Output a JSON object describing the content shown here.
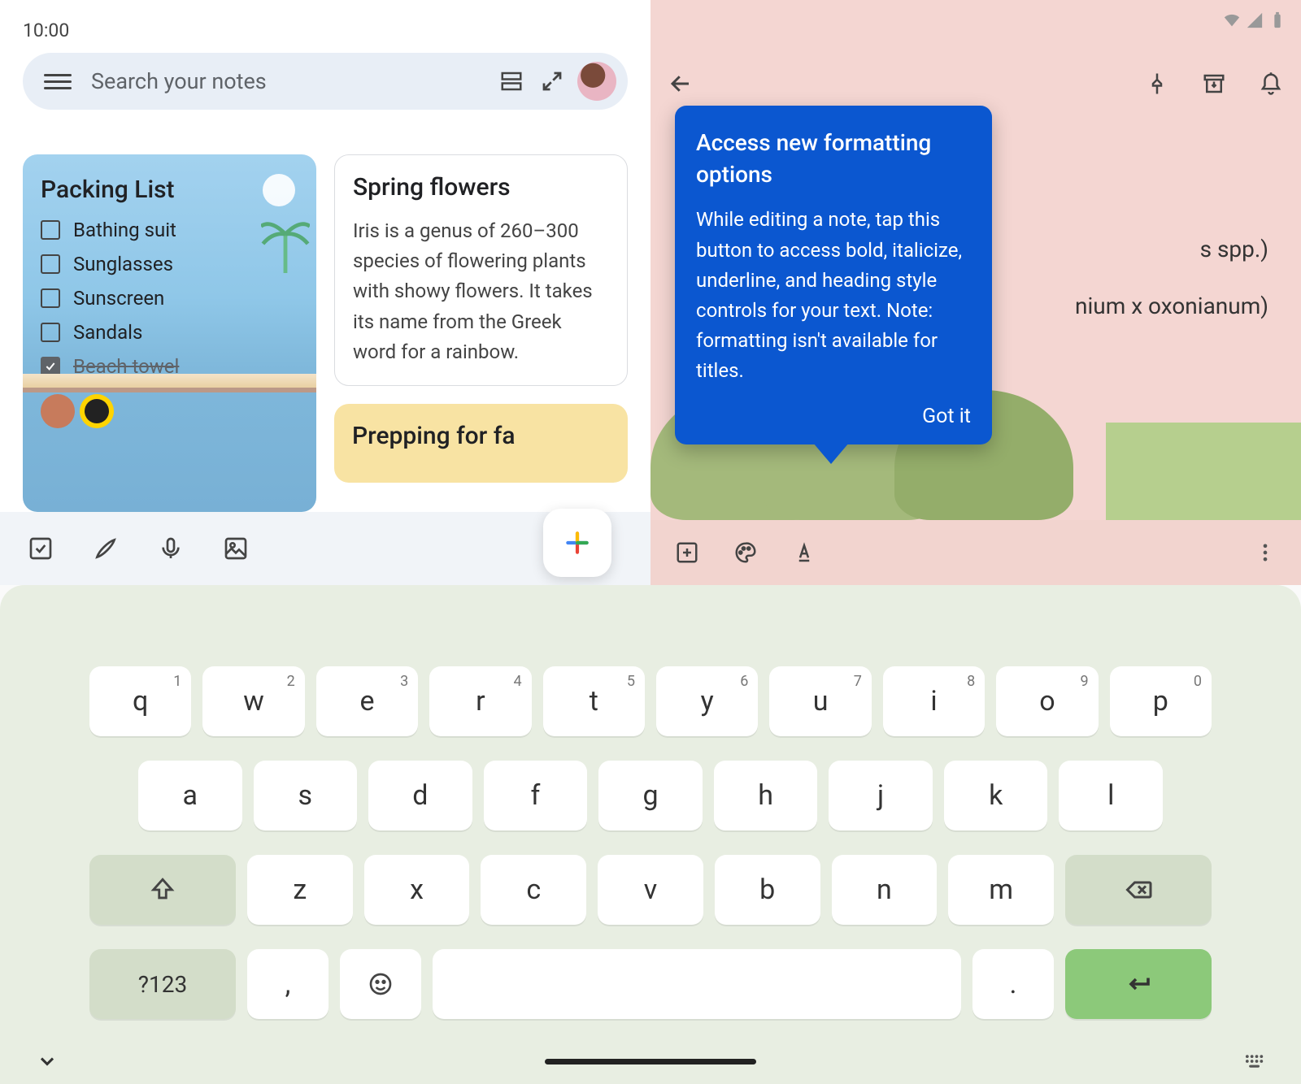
{
  "status": {
    "time": "10:00"
  },
  "search": {
    "placeholder": "Search your notes"
  },
  "notes": {
    "packing": {
      "title": "Packing List",
      "items": [
        {
          "label": "Bathing suit",
          "done": false
        },
        {
          "label": "Sunglasses",
          "done": false
        },
        {
          "label": "Sunscreen",
          "done": false
        },
        {
          "label": "Sandals",
          "done": false
        },
        {
          "label": "Beach towel",
          "done": true
        }
      ]
    },
    "spring": {
      "title": "Spring flowers",
      "body": "Iris is a genus of 260–300 species of flowering plants with showy flowers. It takes its name from the Greek word for a rainbow."
    },
    "yellow": {
      "title": "Prepping for fa"
    }
  },
  "editor": {
    "fragments": [
      "s spp.)",
      "nium x oxonianum)"
    ]
  },
  "tooltip": {
    "title": "Access new formatting options",
    "body": "While editing a note, tap this button to access bold, italicize, underline, and heading style controls for your text. Note: formatting isn't available for titles.",
    "cta": "Got it"
  },
  "keyboard": {
    "row1": [
      {
        "k": "q",
        "n": "1"
      },
      {
        "k": "w",
        "n": "2"
      },
      {
        "k": "e",
        "n": "3"
      },
      {
        "k": "r",
        "n": "4"
      },
      {
        "k": "t",
        "n": "5"
      },
      {
        "k": "y",
        "n": "6"
      },
      {
        "k": "u",
        "n": "7"
      },
      {
        "k": "i",
        "n": "8"
      },
      {
        "k": "o",
        "n": "9"
      },
      {
        "k": "p",
        "n": "0"
      }
    ],
    "row2": [
      "a",
      "s",
      "d",
      "f",
      "g",
      "h",
      "j",
      "k",
      "l"
    ],
    "row3": [
      "z",
      "x",
      "c",
      "v",
      "b",
      "n",
      "m"
    ],
    "sym": "?123",
    "comma": ",",
    "period": "."
  }
}
